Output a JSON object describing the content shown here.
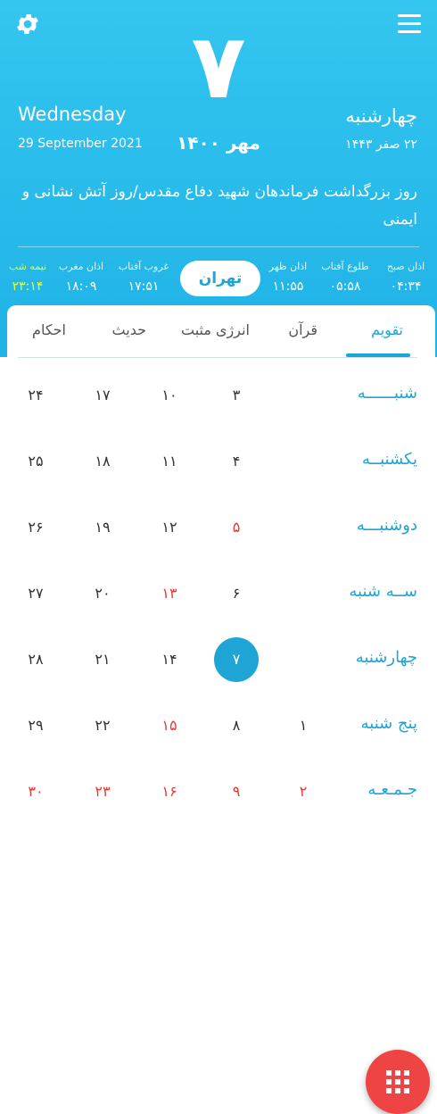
{
  "header": {
    "day_number": "۷",
    "weekday_en": "Wednesday",
    "weekday_fa": "چهارشنبه",
    "date_en": "29 September 2021",
    "month_year_fa": "مهر ۱۴۰۰",
    "date_hijri": "۲۲ صفر ۱۴۴۳",
    "occasion": "روز بزرگداشت فرماندهان شهید دفاع مقدس/روز آتش نشانی و ایمنی"
  },
  "prayers": [
    {
      "label": "اذان صبح",
      "time": "۰۴:۳۴"
    },
    {
      "label": "طلوع آفتاب",
      "time": "۰۵:۵۸"
    },
    {
      "label": "اذان ظهر",
      "time": "۱۱:۵۵"
    },
    {
      "label": "غروب آفتاب",
      "time": "۱۷:۵۱"
    },
    {
      "label": "اذان مغرب",
      "time": "۱۸:۰۹"
    },
    {
      "label": "نیمه شب",
      "time": "۲۳:۱۴"
    }
  ],
  "city": "تهران",
  "tabs": [
    "تقویم",
    "قرآن",
    "انرژی مثبت",
    "حدیث",
    "احکام"
  ],
  "weekday_rows": [
    "شنبــــــه",
    "یکشنبــه",
    "دوشنبـــه",
    "ســه شنبه",
    "چهارشنبه",
    "پنج شنبه",
    "جـمـعـه"
  ],
  "calendar": [
    [
      "",
      "۳",
      "۱۰",
      "۱۷",
      "۲۴"
    ],
    [
      "",
      "۴",
      "۱۱",
      "۱۸",
      "۲۵"
    ],
    [
      "",
      "۵",
      "۱۲",
      "۱۹",
      "۲۶"
    ],
    [
      "",
      "۶",
      "۱۳",
      "۲۰",
      "۲۷"
    ],
    [
      "",
      "۷",
      "۱۴",
      "۲۱",
      "۲۸"
    ],
    [
      "۱",
      "۸",
      "۱۵",
      "۲۲",
      "۲۹"
    ],
    [
      "۲",
      "۹",
      "۱۶",
      "۲۳",
      "۳۰"
    ]
  ],
  "colors": {
    "accent": "#1fa4d6",
    "holiday": "#e53935",
    "fab": "#ef4444"
  }
}
